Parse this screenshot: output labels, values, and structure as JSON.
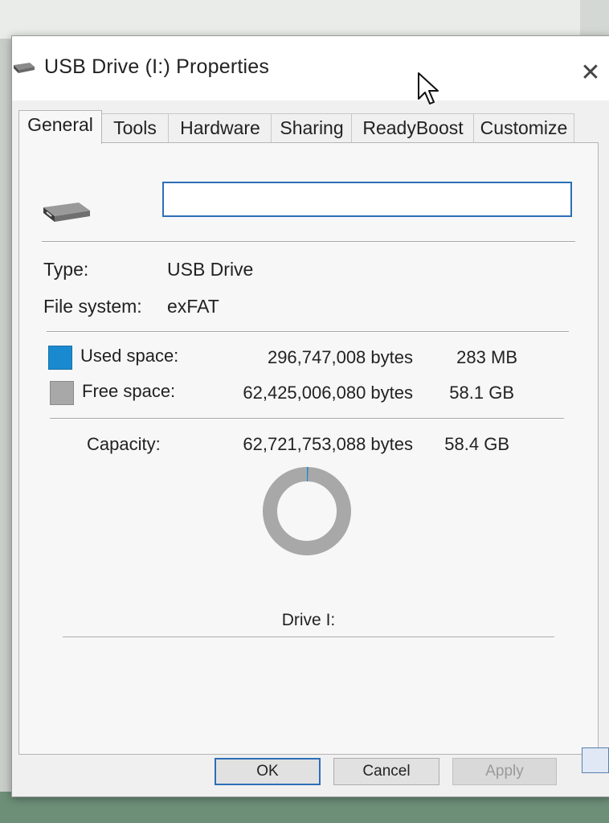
{
  "window": {
    "title": "USB Drive (I:) Properties",
    "close_glyph": "✕"
  },
  "tabs": [
    {
      "label": "General",
      "active": true
    },
    {
      "label": "Tools",
      "active": false
    },
    {
      "label": "Hardware",
      "active": false
    },
    {
      "label": "Sharing",
      "active": false
    },
    {
      "label": "ReadyBoost",
      "active": false
    },
    {
      "label": "Customize",
      "active": false
    }
  ],
  "general": {
    "drive_name_value": "",
    "type_label": "Type:",
    "type_value": "USB Drive",
    "fs_label": "File system:",
    "fs_value": "exFAT",
    "used_label": "Used space:",
    "used_bytes": "296,747,008 bytes",
    "used_size": "283 MB",
    "free_label": "Free space:",
    "free_bytes": "62,425,006,080 bytes",
    "free_size": "58.1 GB",
    "capacity_label": "Capacity:",
    "capacity_bytes": "62,721,753,088 bytes",
    "capacity_size": "58.4 GB",
    "drive_label": "Drive I:"
  },
  "usage": {
    "used_fraction": 0.0047
  },
  "colors": {
    "used": "#1a8ad0",
    "free": "#a8a8a8",
    "accent": "#2d6eb8"
  },
  "buttons": {
    "ok": "OK",
    "cancel": "Cancel",
    "apply": "Apply"
  },
  "icons": [
    "usb-drive-icon",
    "close-icon",
    "mouse-cursor-icon",
    "used-space-swatch",
    "free-space-swatch"
  ]
}
